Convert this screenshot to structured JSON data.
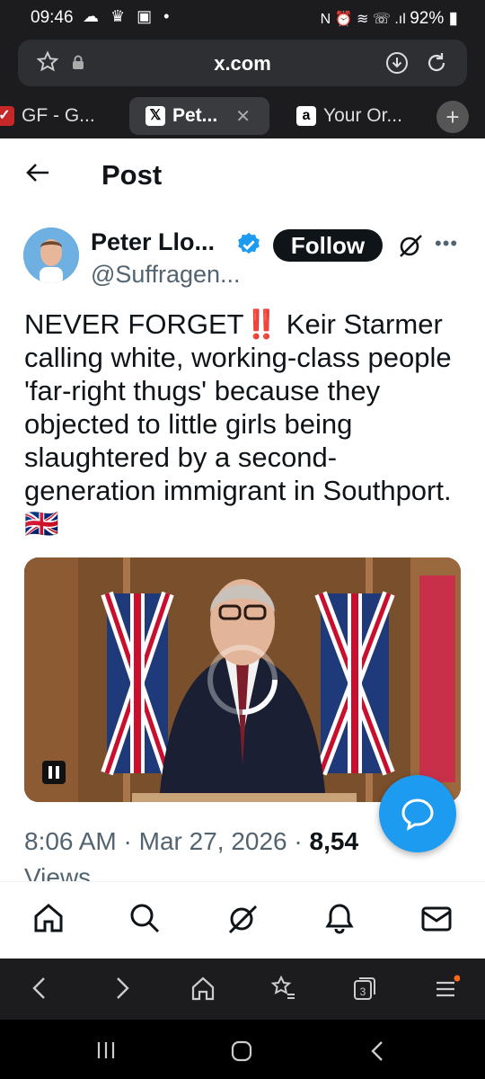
{
  "status_bar": {
    "time": "09:46",
    "battery": "92%"
  },
  "browser": {
    "url": "x.com",
    "tabs": [
      {
        "label": "GF - G..."
      },
      {
        "label": "Pet..."
      },
      {
        "label": "Your Or..."
      }
    ]
  },
  "header": {
    "title": "Post"
  },
  "tweet": {
    "author_name": "Peter Llo...",
    "author_handle": "@Suffragen...",
    "follow_label": "Follow",
    "text": "NEVER FORGET‼️ Keir Starmer calling white, working-class people 'far-right thugs' because they objected to little girls being slaughtered by a second-generation immigrant in Southport. 🇬🇧",
    "time": "8:06 AM",
    "date": "Mar 27, 2026",
    "views_count": "8,54",
    "views_label": "Views"
  },
  "icons": {
    "back": "back-arrow-icon",
    "verified": "verified-badge-icon",
    "grok": "grok-icon",
    "more": "more-options-icon",
    "pause": "pause-icon",
    "fab": "compose-reply-icon"
  },
  "colors": {
    "accent": "#1d9bf0",
    "follow_bg": "#0f1419",
    "text": "#0f1419",
    "muted": "#536471"
  }
}
